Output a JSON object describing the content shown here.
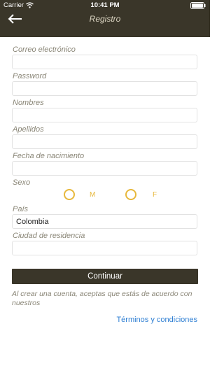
{
  "status_bar": {
    "carrier": "Carrier",
    "time": "10:41 PM"
  },
  "header": {
    "title": "Registro",
    "back_icon": "back-arrow-icon"
  },
  "form": {
    "email": {
      "label": "Correo electrónico",
      "value": ""
    },
    "password": {
      "label": "Password",
      "value": ""
    },
    "first_names": {
      "label": "Nombres",
      "value": ""
    },
    "last_names": {
      "label": "Apellidos",
      "value": ""
    },
    "birth_date": {
      "label": "Fecha de nacimiento",
      "value": ""
    },
    "sex": {
      "label": "Sexo",
      "option_male": "M",
      "option_female": "F",
      "selected": ""
    },
    "country": {
      "label": "País",
      "value": "Colombia"
    },
    "city": {
      "label": "Ciudad de residencia",
      "value": ""
    }
  },
  "continue_label": "Continuar",
  "terms_note": "Al crear una cuenta, aceptas que estás de acuerdo con nuestros",
  "terms_link": "Términos y condiciones",
  "colors": {
    "header_bg": "#3a3629",
    "accent_gold": "#e7b83c",
    "link_blue": "#2f7fd3"
  }
}
